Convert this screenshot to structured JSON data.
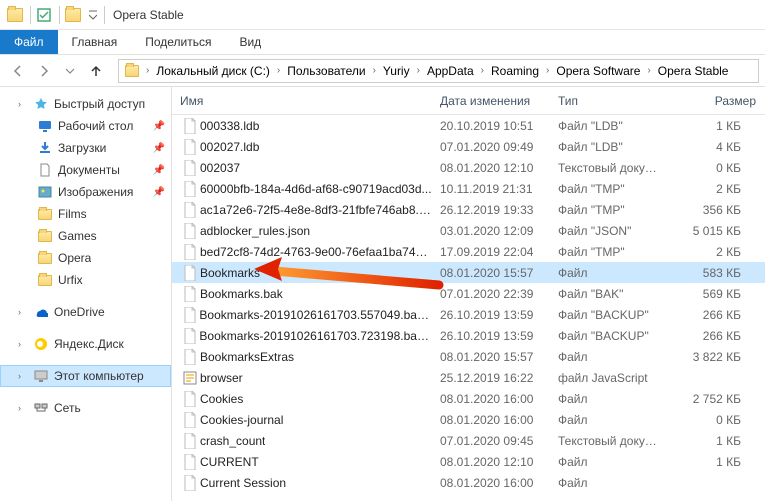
{
  "window_title": "Opera Stable",
  "ribbon": {
    "file": "Файл",
    "home": "Главная",
    "share": "Поделиться",
    "view": "Вид"
  },
  "breadcrumb": [
    "Локальный диск (C:)",
    "Пользователи",
    "Yuriy",
    "AppData",
    "Roaming",
    "Opera Software",
    "Opera Stable"
  ],
  "sidebar": {
    "quick": "Быстрый доступ",
    "desktop": "Рабочий стол",
    "downloads": "Загрузки",
    "documents": "Документы",
    "pictures": "Изображения",
    "films": "Films",
    "games": "Games",
    "opera": "Opera",
    "urfix": "Urfix",
    "onedrive": "OneDrive",
    "yandex": "Яндекс.Диск",
    "thispc": "Этот компьютер",
    "network": "Сеть"
  },
  "columns": {
    "name": "Имя",
    "date": "Дата изменения",
    "type": "Тип",
    "size": "Размер"
  },
  "files": [
    {
      "name": "000338.ldb",
      "date": "20.10.2019 10:51",
      "type": "Файл \"LDB\"",
      "size": "1 КБ"
    },
    {
      "name": "002027.ldb",
      "date": "07.01.2020 09:49",
      "type": "Файл \"LDB\"",
      "size": "4 КБ"
    },
    {
      "name": "002037",
      "date": "08.01.2020 12:10",
      "type": "Текстовый докум...",
      "size": "0 КБ"
    },
    {
      "name": "60000bfb-184a-4d6d-af68-c90719acd03d...",
      "date": "10.11.2019 21:31",
      "type": "Файл \"TMP\"",
      "size": "2 КБ"
    },
    {
      "name": "ac1a72e6-72f5-4e8e-8df3-21fbfe746ab8.t...",
      "date": "26.12.2019 19:33",
      "type": "Файл \"TMP\"",
      "size": "356 КБ"
    },
    {
      "name": "adblocker_rules.json",
      "date": "03.01.2020 12:09",
      "type": "Файл \"JSON\"",
      "size": "5 015 КБ"
    },
    {
      "name": "bed72cf8-74d2-4763-9e00-76efaa1ba74b...",
      "date": "17.09.2019 22:04",
      "type": "Файл \"TMP\"",
      "size": "2 КБ"
    },
    {
      "name": "Bookmarks",
      "date": "08.01.2020 15:57",
      "type": "Файл",
      "size": "583 КБ",
      "selected": true
    },
    {
      "name": "Bookmarks.bak",
      "date": "07.01.2020 22:39",
      "type": "Файл \"BAK\"",
      "size": "569 КБ"
    },
    {
      "name": "Bookmarks-20191026161703.557049.back...",
      "date": "26.10.2019 13:59",
      "type": "Файл \"BACKUP\"",
      "size": "266 КБ"
    },
    {
      "name": "Bookmarks-20191026161703.723198.back...",
      "date": "26.10.2019 13:59",
      "type": "Файл \"BACKUP\"",
      "size": "266 КБ"
    },
    {
      "name": "BookmarksExtras",
      "date": "08.01.2020 15:57",
      "type": "Файл",
      "size": "3 822 КБ"
    },
    {
      "name": "browser",
      "date": "25.12.2019 16:22",
      "type": "файл JavaScript",
      "size": ""
    },
    {
      "name": "Cookies",
      "date": "08.01.2020 16:00",
      "type": "Файл",
      "size": "2 752 КБ"
    },
    {
      "name": "Cookies-journal",
      "date": "08.01.2020 16:00",
      "type": "Файл",
      "size": "0 КБ"
    },
    {
      "name": "crash_count",
      "date": "07.01.2020 09:45",
      "type": "Текстовый докум...",
      "size": "1 КБ"
    },
    {
      "name": "CURRENT",
      "date": "08.01.2020 12:10",
      "type": "Файл",
      "size": "1 КБ"
    },
    {
      "name": "Current Session",
      "date": "08.01.2020 16:00",
      "type": "Файл",
      "size": ""
    }
  ]
}
